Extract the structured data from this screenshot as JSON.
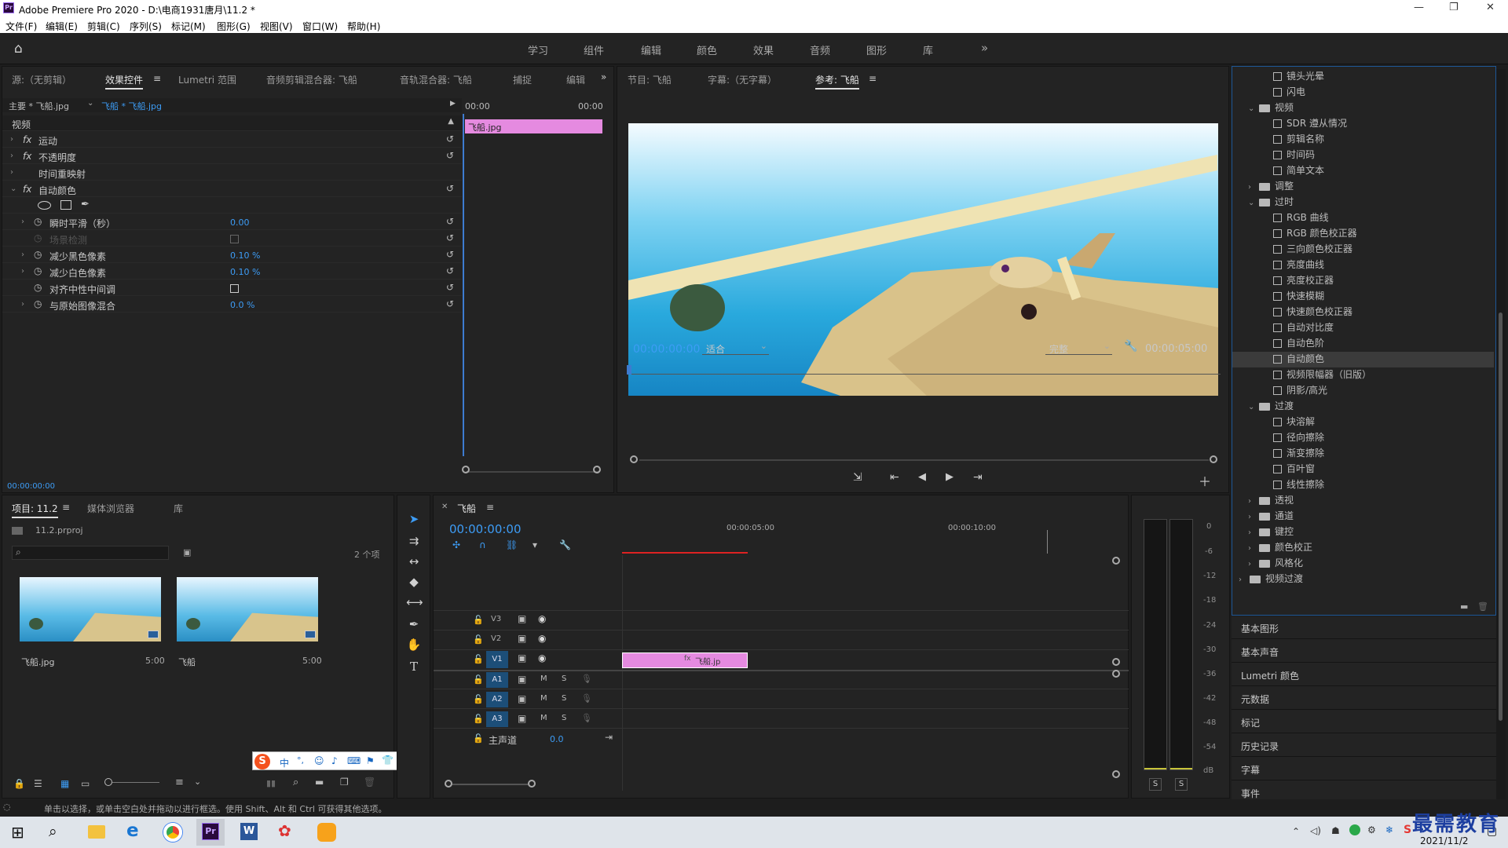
{
  "app": {
    "title": "Adobe Premiere Pro 2020 - D:\\电商1931唐月\\11.2 *",
    "logo": "Pr"
  },
  "menu": [
    "文件(F)",
    "编辑(E)",
    "剪辑(C)",
    "序列(S)",
    "标记(M)",
    "图形(G)",
    "视图(V)",
    "窗口(W)",
    "帮助(H)"
  ],
  "workspaces": [
    "学习",
    "组件",
    "编辑",
    "颜色",
    "效果",
    "音频",
    "图形",
    "库"
  ],
  "effect_panel": {
    "tabs": [
      "源:（无剪辑）",
      "效果控件",
      "Lumetri 范围",
      "音频剪辑混合器: 飞船",
      "音轨混合器: 飞船",
      "捕捉",
      "编辑"
    ],
    "active_tab": "效果控件",
    "master": "主要 * 飞船.jpg",
    "seq": "飞船 * 飞船.jpg",
    "time_left": "00:00",
    "time_right": "00:00",
    "clip": "飞船.jpg",
    "section": "视频",
    "effects": [
      "运动",
      "不透明度",
      "时间重映射",
      "自动颜色"
    ],
    "params": [
      {
        "label": "瞬时平滑（秒）",
        "value": "0.00"
      },
      {
        "label": "场景检测",
        "value": ""
      },
      {
        "label": "减少黑色像素",
        "value": "0.10 %"
      },
      {
        "label": "减少白色像素",
        "value": "0.10 %"
      },
      {
        "label": "对齐中性中间调",
        "value": ""
      },
      {
        "label": "与原始图像混合",
        "value": "0.0 %"
      }
    ],
    "timecode": "00:00:00:00"
  },
  "program": {
    "tabs": [
      "节目: 飞船",
      "字幕:（无字幕）",
      "参考: 飞船"
    ],
    "timecode": "00:00:00:00",
    "fit": "适合",
    "quality": "完整",
    "duration": "00:00:05:00"
  },
  "effects_tree": [
    {
      "kind": "item",
      "text": "镜头光晕",
      "level": 3
    },
    {
      "kind": "item",
      "text": "闪电",
      "level": 3
    },
    {
      "kind": "folder",
      "text": "视频",
      "level": 2,
      "open": true
    },
    {
      "kind": "item",
      "text": "SDR 遵从情况",
      "level": 3
    },
    {
      "kind": "item",
      "text": "剪辑名称",
      "level": 3
    },
    {
      "kind": "item",
      "text": "时间码",
      "level": 3
    },
    {
      "kind": "item",
      "text": "简单文本",
      "level": 3
    },
    {
      "kind": "folder",
      "text": "调整",
      "level": 2,
      "open": false
    },
    {
      "kind": "folder",
      "text": "过时",
      "level": 2,
      "open": true
    },
    {
      "kind": "item",
      "text": "RGB 曲线",
      "level": 3
    },
    {
      "kind": "item",
      "text": "RGB 颜色校正器",
      "level": 3
    },
    {
      "kind": "item",
      "text": "三向颜色校正器",
      "level": 3
    },
    {
      "kind": "item",
      "text": "亮度曲线",
      "level": 3
    },
    {
      "kind": "item",
      "text": "亮度校正器",
      "level": 3
    },
    {
      "kind": "item",
      "text": "快速模糊",
      "level": 3
    },
    {
      "kind": "item",
      "text": "快速颜色校正器",
      "level": 3
    },
    {
      "kind": "item",
      "text": "自动对比度",
      "level": 3
    },
    {
      "kind": "item",
      "text": "自动色阶",
      "level": 3
    },
    {
      "kind": "item",
      "text": "自动颜色",
      "level": 3,
      "selected": true
    },
    {
      "kind": "item",
      "text": "视频限幅器（旧版）",
      "level": 3
    },
    {
      "kind": "item",
      "text": "阴影/高光",
      "level": 3
    },
    {
      "kind": "folder",
      "text": "过渡",
      "level": 2,
      "open": true
    },
    {
      "kind": "item",
      "text": "块溶解",
      "level": 3
    },
    {
      "kind": "item",
      "text": "径向擦除",
      "level": 3
    },
    {
      "kind": "item",
      "text": "渐变擦除",
      "level": 3
    },
    {
      "kind": "item",
      "text": "百叶窗",
      "level": 3
    },
    {
      "kind": "item",
      "text": "线性擦除",
      "level": 3
    },
    {
      "kind": "folder",
      "text": "透视",
      "level": 2,
      "open": false
    },
    {
      "kind": "folder",
      "text": "通道",
      "level": 2,
      "open": false
    },
    {
      "kind": "folder",
      "text": "键控",
      "level": 2,
      "open": false
    },
    {
      "kind": "folder",
      "text": "颜色校正",
      "level": 2,
      "open": false
    },
    {
      "kind": "folder",
      "text": "风格化",
      "level": 2,
      "open": false
    },
    {
      "kind": "folder",
      "text": "视频过渡",
      "level": 1,
      "open": false
    }
  ],
  "right_panels": [
    "基本图形",
    "基本声音",
    "Lumetri 颜色",
    "元数据",
    "标记",
    "历史记录",
    "字幕",
    "事件"
  ],
  "project": {
    "tabs": [
      "项目: 11.2",
      "媒体浏览器",
      "库"
    ],
    "file": "11.2.prproj",
    "count": "2 个项",
    "items": [
      {
        "name": "飞船.jpg",
        "dur": "5:00"
      },
      {
        "name": "飞船",
        "dur": "5:00"
      }
    ]
  },
  "timeline": {
    "tab": "飞船",
    "timecode": "00:00:00:00",
    "ruler": [
      "00:00:05:00",
      "00:00:10:00"
    ],
    "video_tracks": [
      "V3",
      "V2",
      "V1"
    ],
    "audio_tracks": [
      "A1",
      "A2",
      "A3"
    ],
    "master": "主声道",
    "master_val": "0.0",
    "clip": "飞船.jp"
  },
  "meter_labels": [
    "0",
    "-6",
    "-12",
    "-18",
    "-24",
    "-30",
    "-36",
    "-42",
    "-48",
    "-54",
    "dB"
  ],
  "meter_solo": [
    "S",
    "S"
  ],
  "ime": [
    "中",
    "°,",
    "☺",
    "♪",
    "⌨",
    "⚑",
    "👕",
    "▦"
  ],
  "status": "单击以选择，或单击空白处并拖动以进行框选。使用 Shift、Alt 和 Ctrl 可获得其他选项。",
  "tray": {
    "time": "",
    "date": "2021/11/2"
  },
  "watermark": "最需教育",
  "colors": {
    "accent": "#3d9cf5",
    "clip": "#e58ae0",
    "panel": "#232323"
  }
}
